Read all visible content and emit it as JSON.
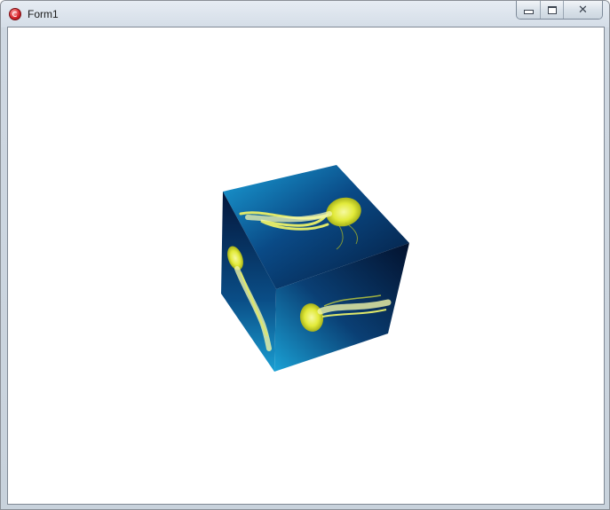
{
  "window": {
    "title": "Form1",
    "icon": "app-icon",
    "controls": {
      "minimize_icon": "minimize-icon",
      "maximize_icon": "restore-icon",
      "close_icon": "close-icon",
      "close_glyph": "✕"
    }
  },
  "canvas": {
    "content": "textured-cube",
    "texture": "jellyfish",
    "colors": {
      "deep": "#051a3a",
      "mid": "#0a4a7e",
      "light": "#1fa3d6",
      "jelly": "#e6ef4a"
    }
  }
}
